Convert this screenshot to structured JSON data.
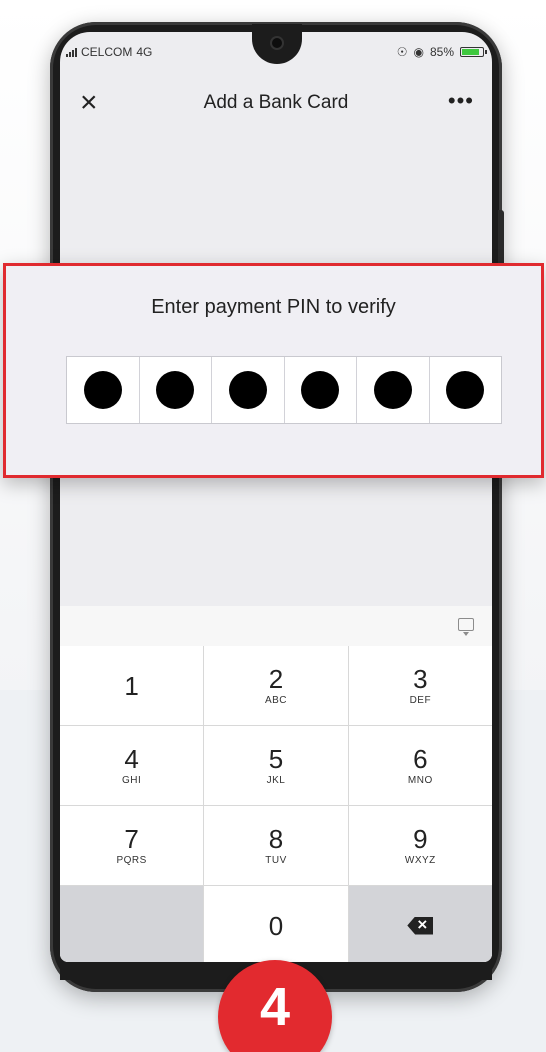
{
  "status_bar": {
    "carrier": "CELCOM",
    "network": "4G",
    "battery": "85%",
    "signal_icon": "signal-bars-icon",
    "status_icons": [
      "location-icon",
      "shield-icon"
    ]
  },
  "nav": {
    "close_icon": "×",
    "title": "Add a Bank Card",
    "more_icon": "•••"
  },
  "pin_prompt": {
    "title": "Enter payment PIN to verify",
    "digits_entered": 6,
    "digits_total": 6
  },
  "keypad": {
    "keys": [
      {
        "num": "1",
        "letters": ""
      },
      {
        "num": "2",
        "letters": "ABC"
      },
      {
        "num": "3",
        "letters": "DEF"
      },
      {
        "num": "4",
        "letters": "GHI"
      },
      {
        "num": "5",
        "letters": "JKL"
      },
      {
        "num": "6",
        "letters": "MNO"
      },
      {
        "num": "7",
        "letters": "PQRS"
      },
      {
        "num": "8",
        "letters": "TUV"
      },
      {
        "num": "9",
        "letters": "WXYZ"
      },
      {
        "num": "0",
        "letters": ""
      }
    ],
    "hide_keyboard_icon": "keyboard-hide-icon",
    "backspace_icon": "backspace-icon"
  },
  "step_badge": "4",
  "colors": {
    "accent_red": "#e02a2f",
    "battery_green": "#3fc83f",
    "screen_bg": "#ededf0"
  }
}
